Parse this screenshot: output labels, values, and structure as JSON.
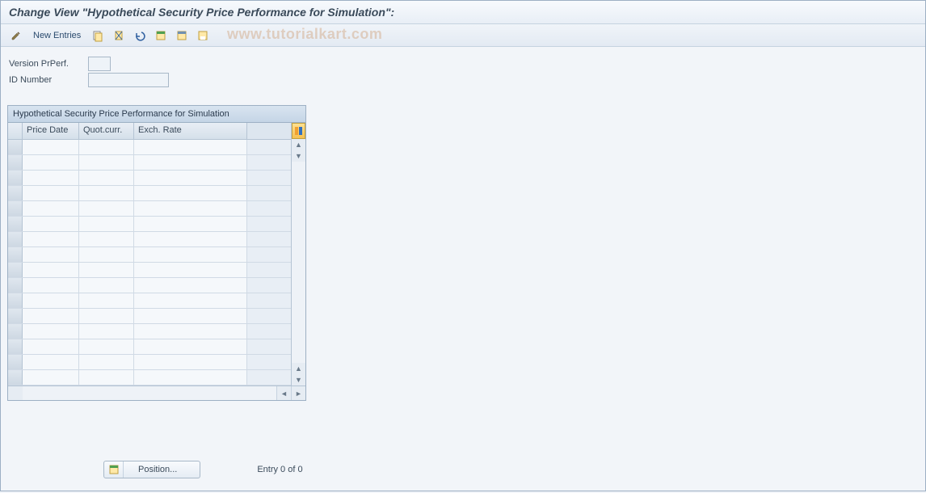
{
  "title": "Change View \"Hypothetical Security Price Performance for Simulation\":",
  "toolbar": {
    "new_entries": "New Entries"
  },
  "watermark": "www.tutorialkart.com",
  "form": {
    "version_label": "Version PrPerf.",
    "version_value": "",
    "id_label": "ID Number",
    "id_value": ""
  },
  "table": {
    "title": "Hypothetical Security Price Performance for Simulation",
    "columns": [
      "Price Date",
      "Quot.curr.",
      "Exch. Rate"
    ],
    "row_count": 16
  },
  "footer": {
    "position_label": "Position...",
    "entry_status": "Entry 0 of 0"
  }
}
